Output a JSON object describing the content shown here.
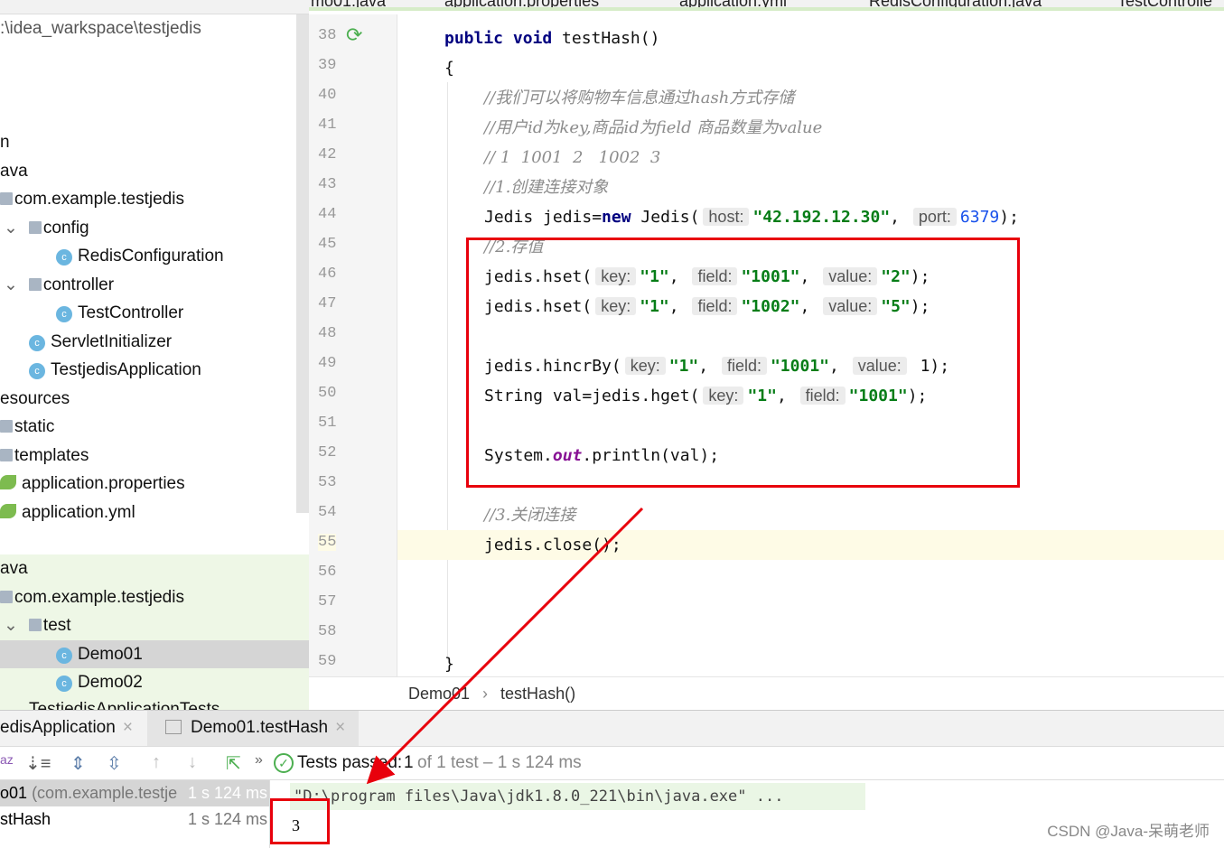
{
  "editor_tabs": [
    "mo01.java",
    "application.properties",
    "application.yml",
    "RedisConfiguration.java",
    "TestControlle"
  ],
  "project_tree": {
    "path": ":\\idea_warkspace\\testjedis",
    "items": [
      {
        "label": "n"
      },
      {
        "label": "ava"
      },
      {
        "label": "com.example.testjedis"
      },
      {
        "label": "config"
      },
      {
        "label": "RedisConfiguration"
      },
      {
        "label": "controller"
      },
      {
        "label": "TestController"
      },
      {
        "label": "ServletInitializer"
      },
      {
        "label": "TestjedisApplication"
      },
      {
        "label": "esources"
      },
      {
        "label": "static"
      },
      {
        "label": "templates"
      },
      {
        "label": "application.properties"
      },
      {
        "label": "application.yml"
      },
      {
        "label": "ava"
      },
      {
        "label": "com.example.testjedis"
      },
      {
        "label": "test"
      },
      {
        "label": "Demo01"
      },
      {
        "label": "Demo02"
      },
      {
        "label": "TestjedisApplicationTests"
      }
    ]
  },
  "code": {
    "line_numbers": [
      "38",
      "39",
      "40",
      "41",
      "42",
      "43",
      "44",
      "45",
      "46",
      "47",
      "48",
      "49",
      "50",
      "51",
      "52",
      "53",
      "54",
      "55",
      "56",
      "57",
      "58",
      "59"
    ],
    "l38": [
      "public void ",
      "testHash()"
    ],
    "l39": "{",
    "l40": "//我们可以将购物车信息通过hash方式存储",
    "l41": "//用户id为key,商品id为field 商品数量为value",
    "l42": "// 1  1001  2   1002  3",
    "l43": "//1.创建连接对象",
    "l44": [
      "Jedis jedis=",
      "new",
      " Jedis(",
      "host:",
      "\"42.192.12.30\"",
      ", ",
      "port:",
      "6379",
      ");"
    ],
    "l45": "//2.存值",
    "l46": [
      "jedis.hset(",
      "key:",
      "\"1\"",
      ", ",
      "field:",
      "\"1001\"",
      ", ",
      "value:",
      "\"2\"",
      ");"
    ],
    "l47": [
      "jedis.hset(",
      "key:",
      "\"1\"",
      ", ",
      "field:",
      "\"1002\"",
      ", ",
      "value:",
      "\"5\"",
      ");"
    ],
    "l49": [
      "jedis.hincrBy(",
      "key:",
      "\"1\"",
      ", ",
      "field:",
      "\"1001\"",
      ", ",
      "value:",
      " 1);"
    ],
    "l50": [
      "String val=jedis.hget(",
      "key:",
      "\"1\"",
      ", ",
      "field:",
      "\"1001\"",
      ");"
    ],
    "l52": [
      "System.",
      "out",
      ".println(val);"
    ],
    "l54": "//3.关闭连接",
    "l55": "jedis.close();",
    "l59": "}"
  },
  "breadcrumb": {
    "class": "Demo01",
    "method": "testHash()"
  },
  "run_tabs": [
    "edisApplication",
    "Demo01.testHash"
  ],
  "status": {
    "label": "Tests passed:",
    "count": "1",
    "detail": "of 1 test – 1 s 124 ms"
  },
  "results": [
    {
      "name": "o01",
      "pkg": "(com.example.testje",
      "time": "1 s 124 ms"
    },
    {
      "name": "stHash",
      "time": "1 s 124 ms"
    }
  ],
  "console": {
    "cmd": "\"D:\\program files\\Java\\jdk1.8.0_221\\bin\\java.exe\" ...",
    "output": "3"
  },
  "watermark": "CSDN @Java-呆萌老师",
  "colors": {
    "annotation": "#e8000c",
    "passed": "#4caf50"
  }
}
